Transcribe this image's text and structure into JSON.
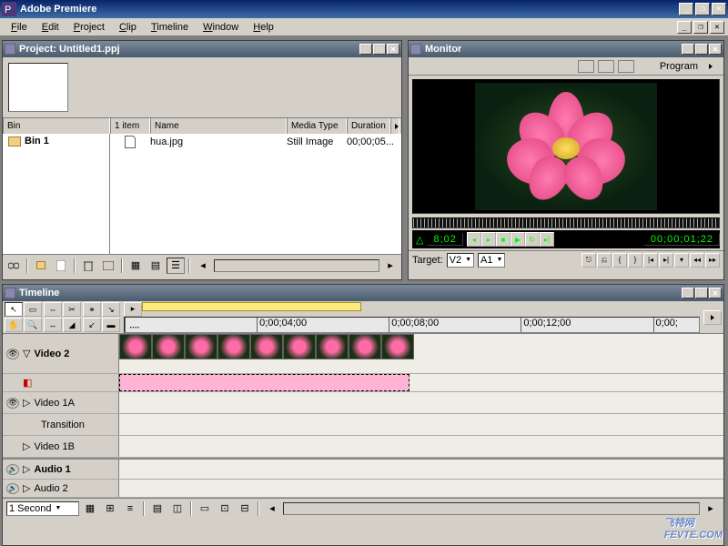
{
  "app": {
    "title": "Adobe Premiere"
  },
  "menu": [
    "File",
    "Edit",
    "Project",
    "Clip",
    "Timeline",
    "Window",
    "Help"
  ],
  "project": {
    "title": "Project: Untitled1.ppj",
    "bin_label": "Bin",
    "item_count": "1 item",
    "cols": {
      "name": "Name",
      "media_type": "Media Type",
      "duration": "Duration"
    },
    "bin_name": "Bin 1",
    "file": {
      "name": "hua.jpg",
      "media_type": "Still Image",
      "duration": "00;00;05..."
    }
  },
  "monitor": {
    "title": "Monitor",
    "program_label": "Program",
    "delta_tc": "8;02",
    "timecode": "00;00;01;22",
    "target_label": "Target:",
    "target_video": "V2",
    "target_audio": "A1"
  },
  "timeline": {
    "title": "Timeline",
    "ruler": [
      "",
      "0;00;04;00",
      "0;00;08;00",
      "0;00;12;00",
      "0;00;"
    ],
    "tracks": {
      "video2": "Video 2",
      "video1a": "Video 1A",
      "transition": "Transition",
      "video1b": "Video 1B",
      "audio1": "Audio 1",
      "audio2": "Audio 2"
    },
    "zoom": "1 Second"
  },
  "watermark": {
    "line1": "飞特网",
    "line2": "FEVTE.COM"
  }
}
